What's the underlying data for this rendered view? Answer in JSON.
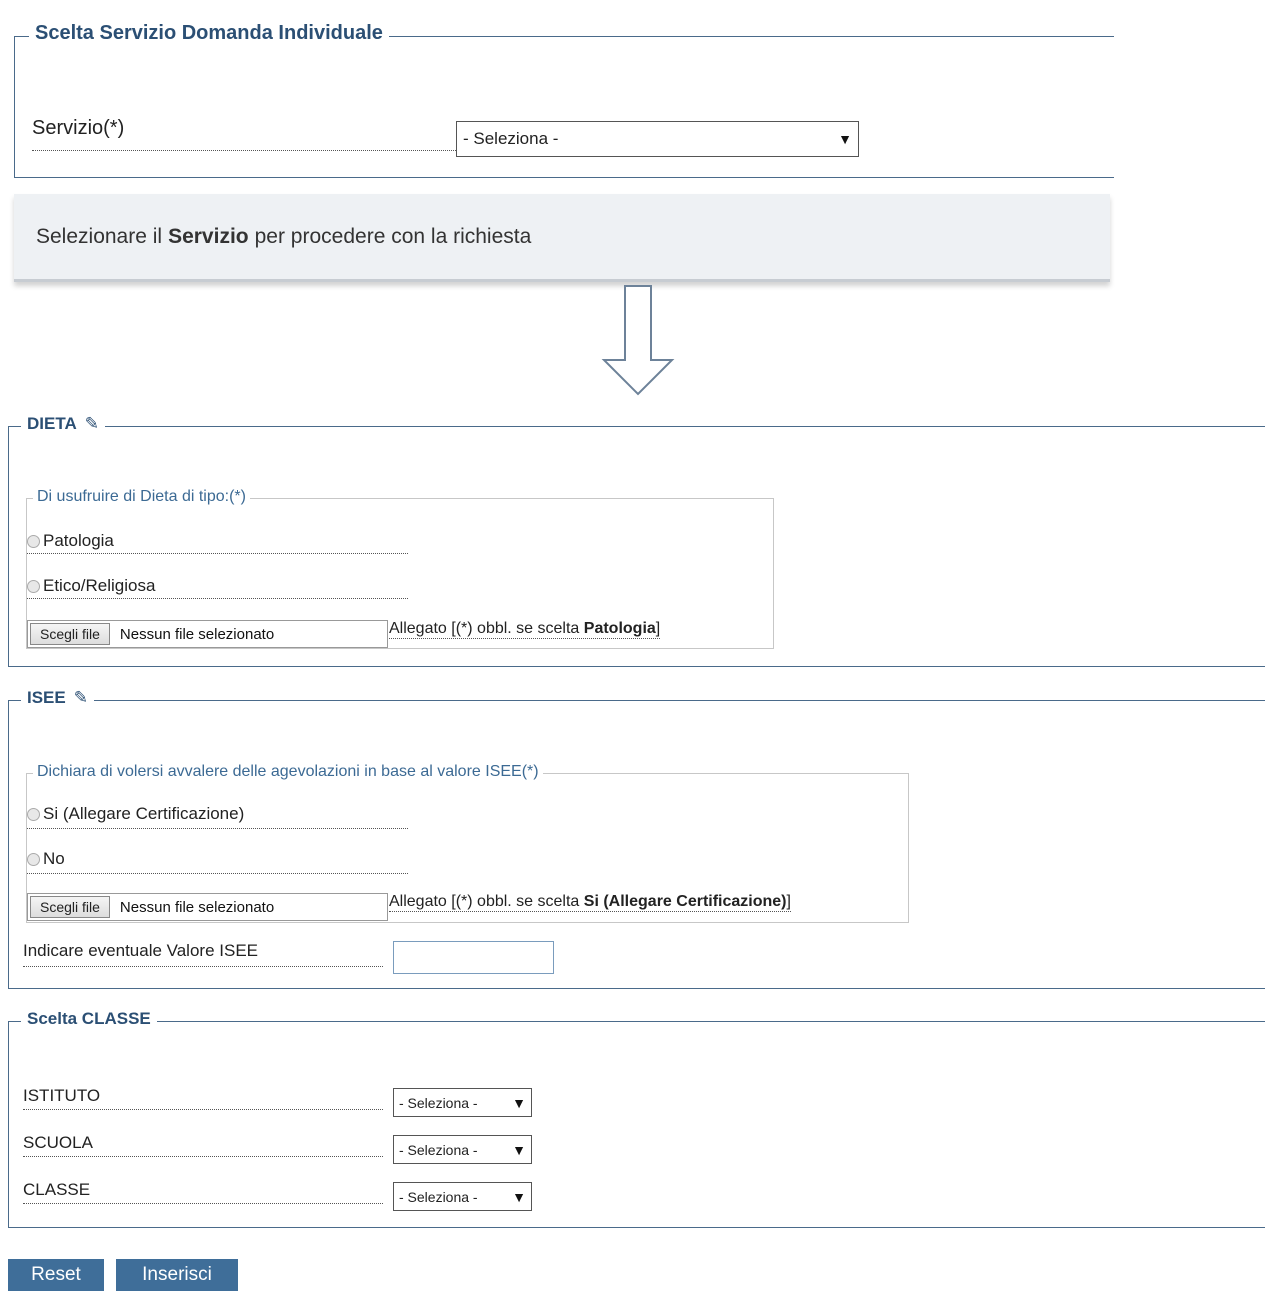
{
  "service_section": {
    "legend": "Scelta Servizio Domanda Individuale",
    "servizio_label": "Servizio(*)",
    "servizio_select": "- Seleziona -"
  },
  "info": {
    "prefix": "Selezionare il",
    "bold": "Servizio",
    "suffix": "per procedere con la richiesta"
  },
  "dieta": {
    "legend": "DIETA",
    "question": "Di usufruire di Dieta di tipo:(*)",
    "options": [
      "Patologia",
      "Etico/Religiosa"
    ],
    "file_button": "Scegli file",
    "file_status": "Nessun file selezionato",
    "attachment_prefix": "Allegato [(*) obbl. se scelta",
    "attachment_bold": "Patologia",
    "attachment_suffix": "]"
  },
  "isee": {
    "legend": "ISEE",
    "question": "Dichiara di volersi avvalere delle agevolazioni in base al valore ISEE(*)",
    "options": [
      "Si (Allegare Certificazione)",
      "No"
    ],
    "file_button": "Scegli file",
    "file_status": "Nessun file selezionato",
    "attachment_prefix": "Allegato [(*) obbl. se scelta",
    "attachment_bold": "Si (Allegare Certificazione)",
    "attachment_suffix": "]",
    "value_label": "Indicare eventuale Valore ISEE",
    "value_input": ""
  },
  "classe": {
    "legend": "Scelta CLASSE",
    "fields": [
      {
        "label": "ISTITUTO",
        "value": "- Seleziona -"
      },
      {
        "label": "SCUOLA",
        "value": "- Seleziona -"
      },
      {
        "label": "CLASSE",
        "value": "- Seleziona -"
      }
    ]
  },
  "buttons": {
    "reset": "Reset",
    "insert": "Inserisci"
  },
  "icons": {
    "select_caret": "triangle-down-icon",
    "section_edit": "eraser-icon",
    "flow_arrow": "arrow-down-icon"
  },
  "colors": {
    "legend": "#2b4f74",
    "button": "#3f6e99",
    "info_bg": "#eef1f4"
  }
}
